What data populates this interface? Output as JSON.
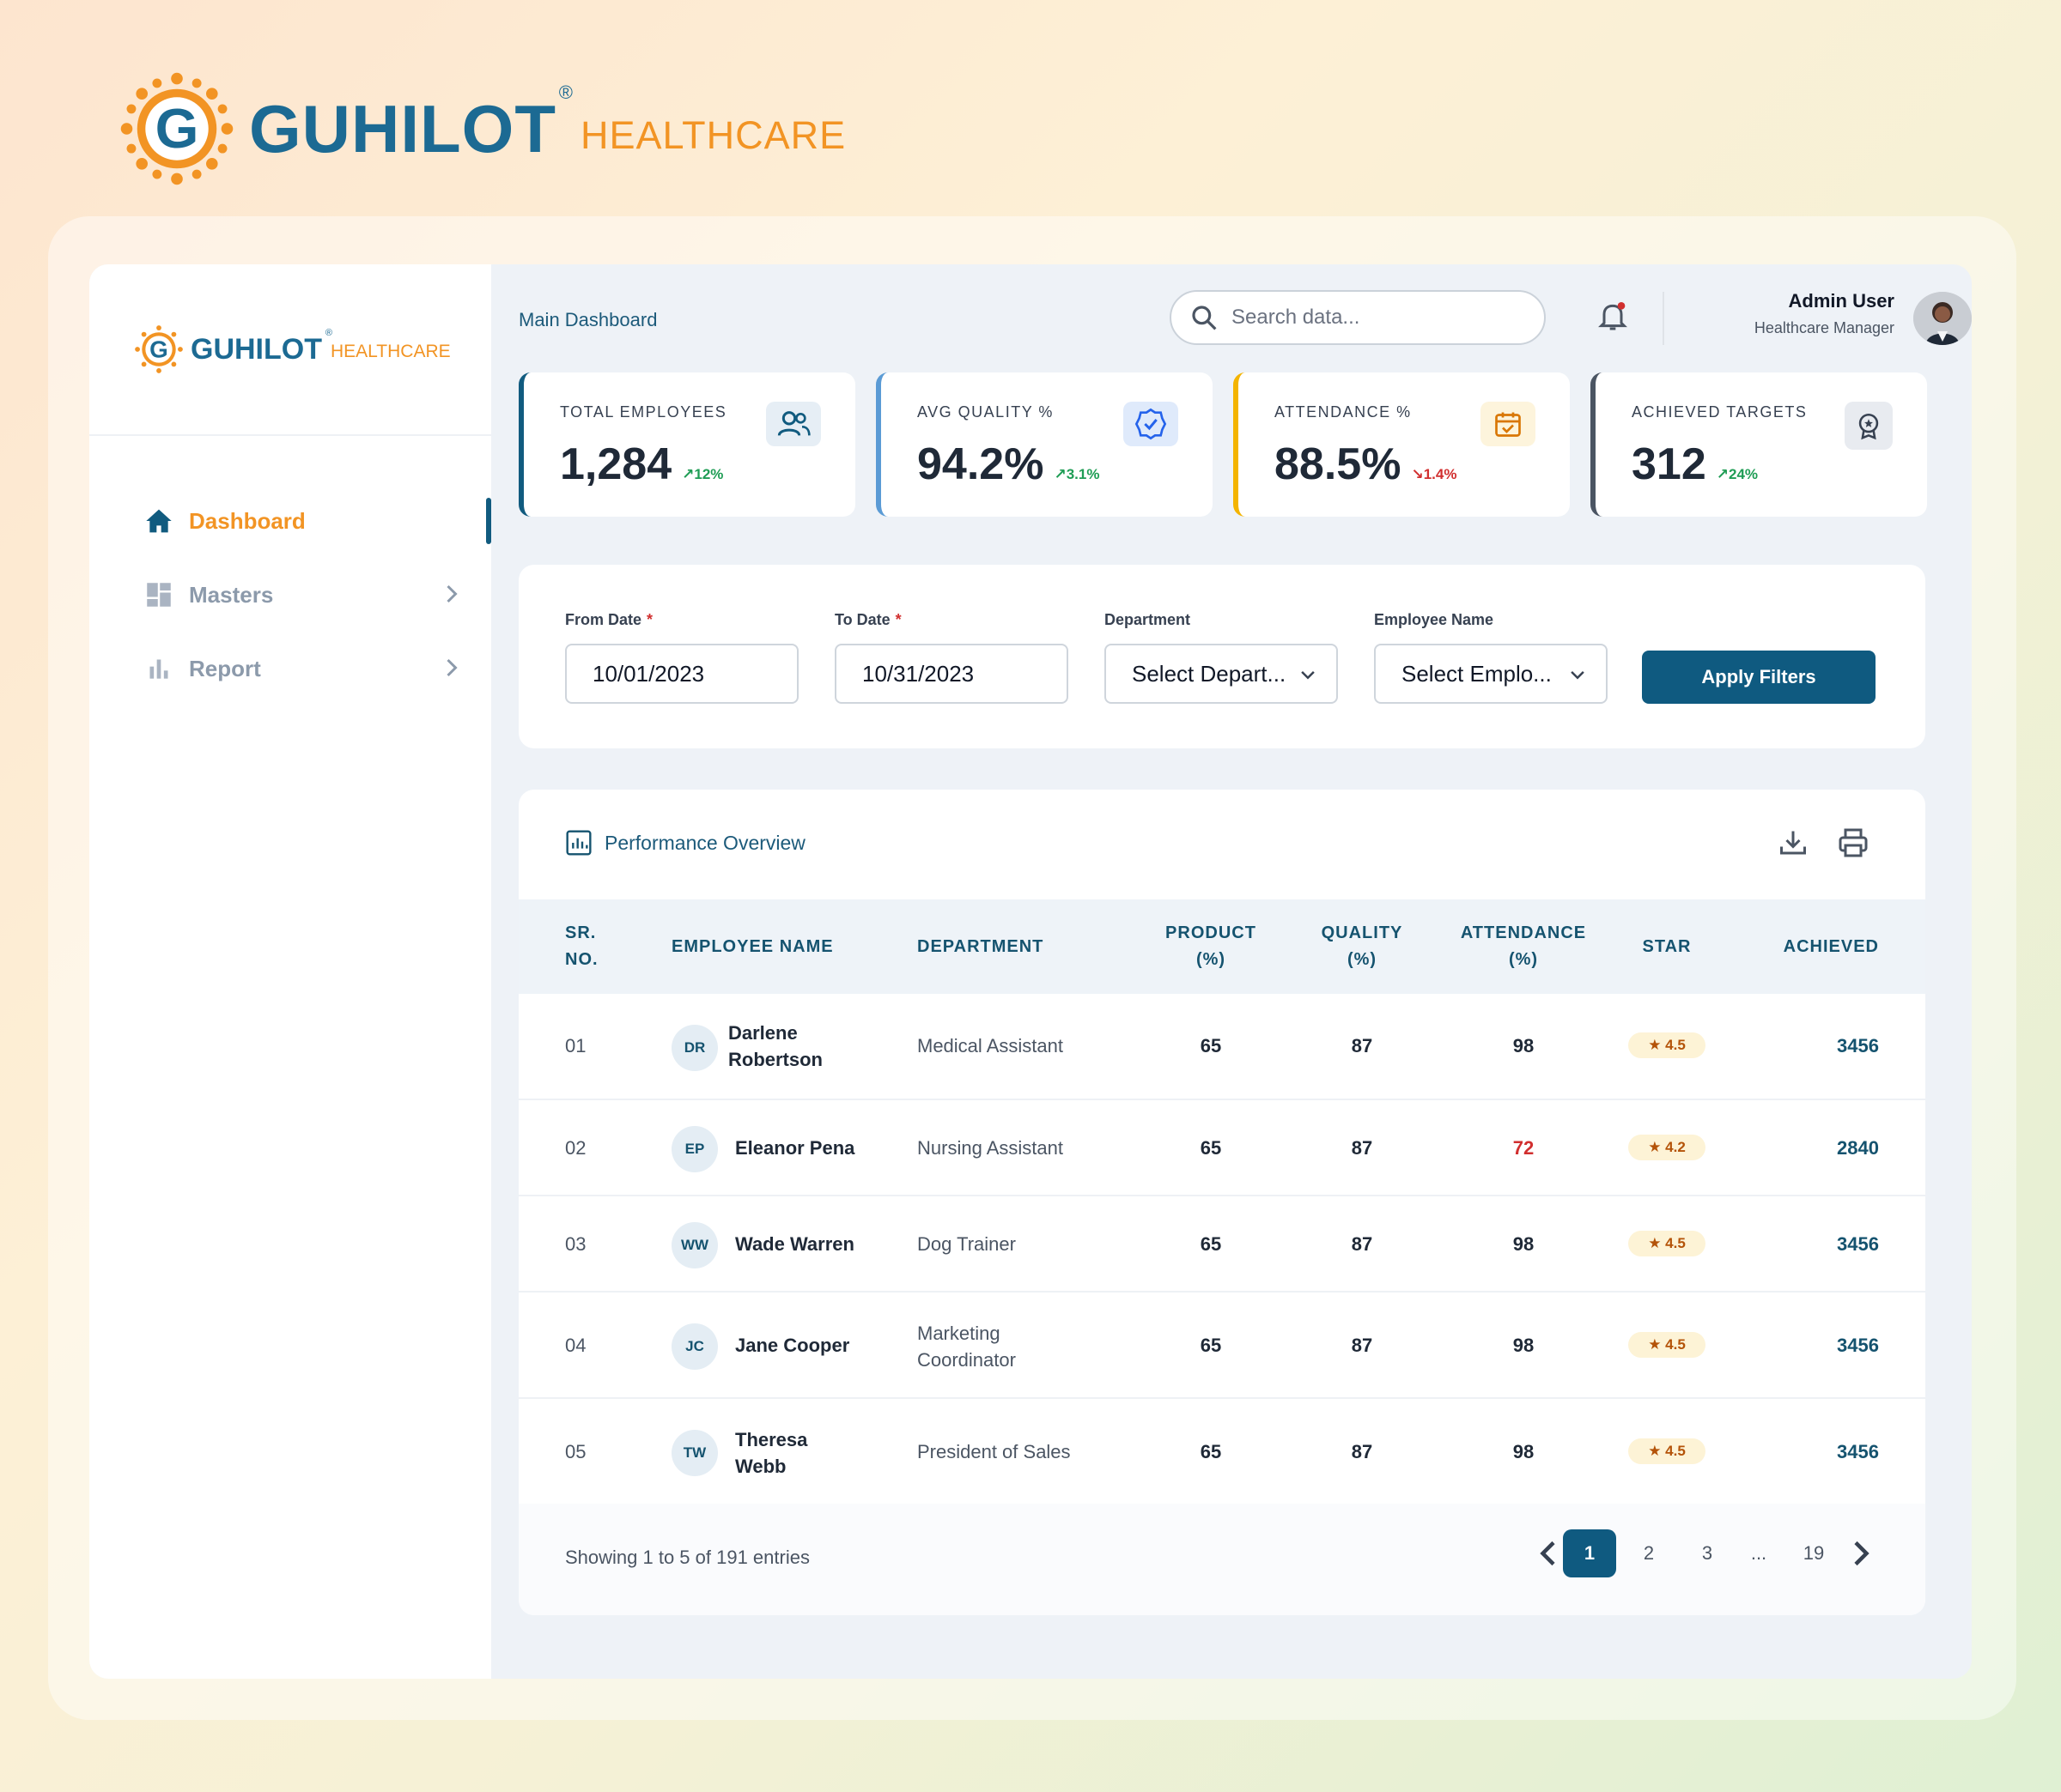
{
  "brand": {
    "name": "GUHILOT",
    "reg": "®",
    "sub": "HEALTHCARE"
  },
  "sidebar": {
    "brand": {
      "name": "GUHILOT",
      "reg": "®",
      "sub": "HEALTHCARE"
    },
    "items": [
      {
        "label": "Dashboard",
        "icon": "home-icon"
      },
      {
        "label": "Masters",
        "icon": "grid-icon"
      },
      {
        "label": "Report",
        "icon": "bar-chart-icon"
      }
    ]
  },
  "header": {
    "breadcrumb": "Main Dashboard",
    "search_placeholder": "Search data...",
    "user_name": "Admin User",
    "user_role": "Healthcare Manager"
  },
  "cards": [
    {
      "title": "TOTAL EMPLOYEES",
      "value": "1,284",
      "delta": "12%",
      "trend": "up",
      "accent": "#115b7f"
    },
    {
      "title": "AVG QUALITY %",
      "value": "94.2%",
      "delta": "3.1%",
      "trend": "up",
      "accent": "#5b9bd5"
    },
    {
      "title": "ATTENDANCE %",
      "value": "88.5%",
      "delta": "1.4%",
      "trend": "down",
      "accent": "#f4b400"
    },
    {
      "title": "ACHIEVED TARGETS",
      "value": "312",
      "delta": "24%",
      "trend": "up",
      "accent": "#4b5563"
    }
  ],
  "filters": {
    "from_label": "From Date",
    "from_value": "10/01/2023",
    "to_label": "To Date",
    "to_value": "10/31/2023",
    "dept_label": "Department",
    "dept_value": "Select Depart...",
    "emp_label": "Employee Name",
    "emp_value": "Select Emplo...",
    "apply": "Apply Filters"
  },
  "table": {
    "title": "Performance Overview",
    "columns": {
      "sr1": "SR.",
      "sr2": "NO.",
      "name": "EMPLOYEE NAME",
      "dept": "DEPARTMENT",
      "prod1": "PRODUCT",
      "prod2": "(%)",
      "qual1": "QUALITY",
      "qual2": "(%)",
      "att1": "ATTENDANCE",
      "att2": "(%)",
      "star": "STAR",
      "ach": "ACHIEVED"
    },
    "rows": [
      {
        "sr": "01",
        "initials": "DR",
        "name1": "Darlene",
        "name2": "Robertson",
        "dept1": "Medical Assistant",
        "dept2": "",
        "product": "65",
        "quality": "87",
        "attendance": "98",
        "star": "4.5",
        "achieved": "3456"
      },
      {
        "sr": "02",
        "initials": "EP",
        "name1": "Eleanor Pena",
        "name2": "",
        "dept1": "Nursing Assistant",
        "dept2": "",
        "product": "65",
        "quality": "87",
        "attendance": "72",
        "star": "4.2",
        "achieved": "2840"
      },
      {
        "sr": "03",
        "initials": "WW",
        "name1": "Wade Warren",
        "name2": "",
        "dept1": "Dog Trainer",
        "dept2": "",
        "product": "65",
        "quality": "87",
        "attendance": "98",
        "star": "4.5",
        "achieved": "3456"
      },
      {
        "sr": "04",
        "initials": "JC",
        "name1": "Jane Cooper",
        "name2": "",
        "dept1": "Marketing",
        "dept2": "Coordinator",
        "product": "65",
        "quality": "87",
        "attendance": "98",
        "star": "4.5",
        "achieved": "3456"
      },
      {
        "sr": "05",
        "initials": "TW",
        "name1": "Theresa",
        "name2": "Webb",
        "dept1": "President of Sales",
        "dept2": "",
        "product": "65",
        "quality": "87",
        "attendance": "98",
        "star": "4.5",
        "achieved": "3456"
      }
    ],
    "footer": "Showing 1 to 5 of 191 entries",
    "pages": [
      "1",
      "2",
      "3",
      "...",
      "19"
    ],
    "current_page": "1"
  },
  "colors": {
    "primary": "#0f5a80",
    "orange": "#f29424",
    "low_attendance": "#d12f2f"
  }
}
